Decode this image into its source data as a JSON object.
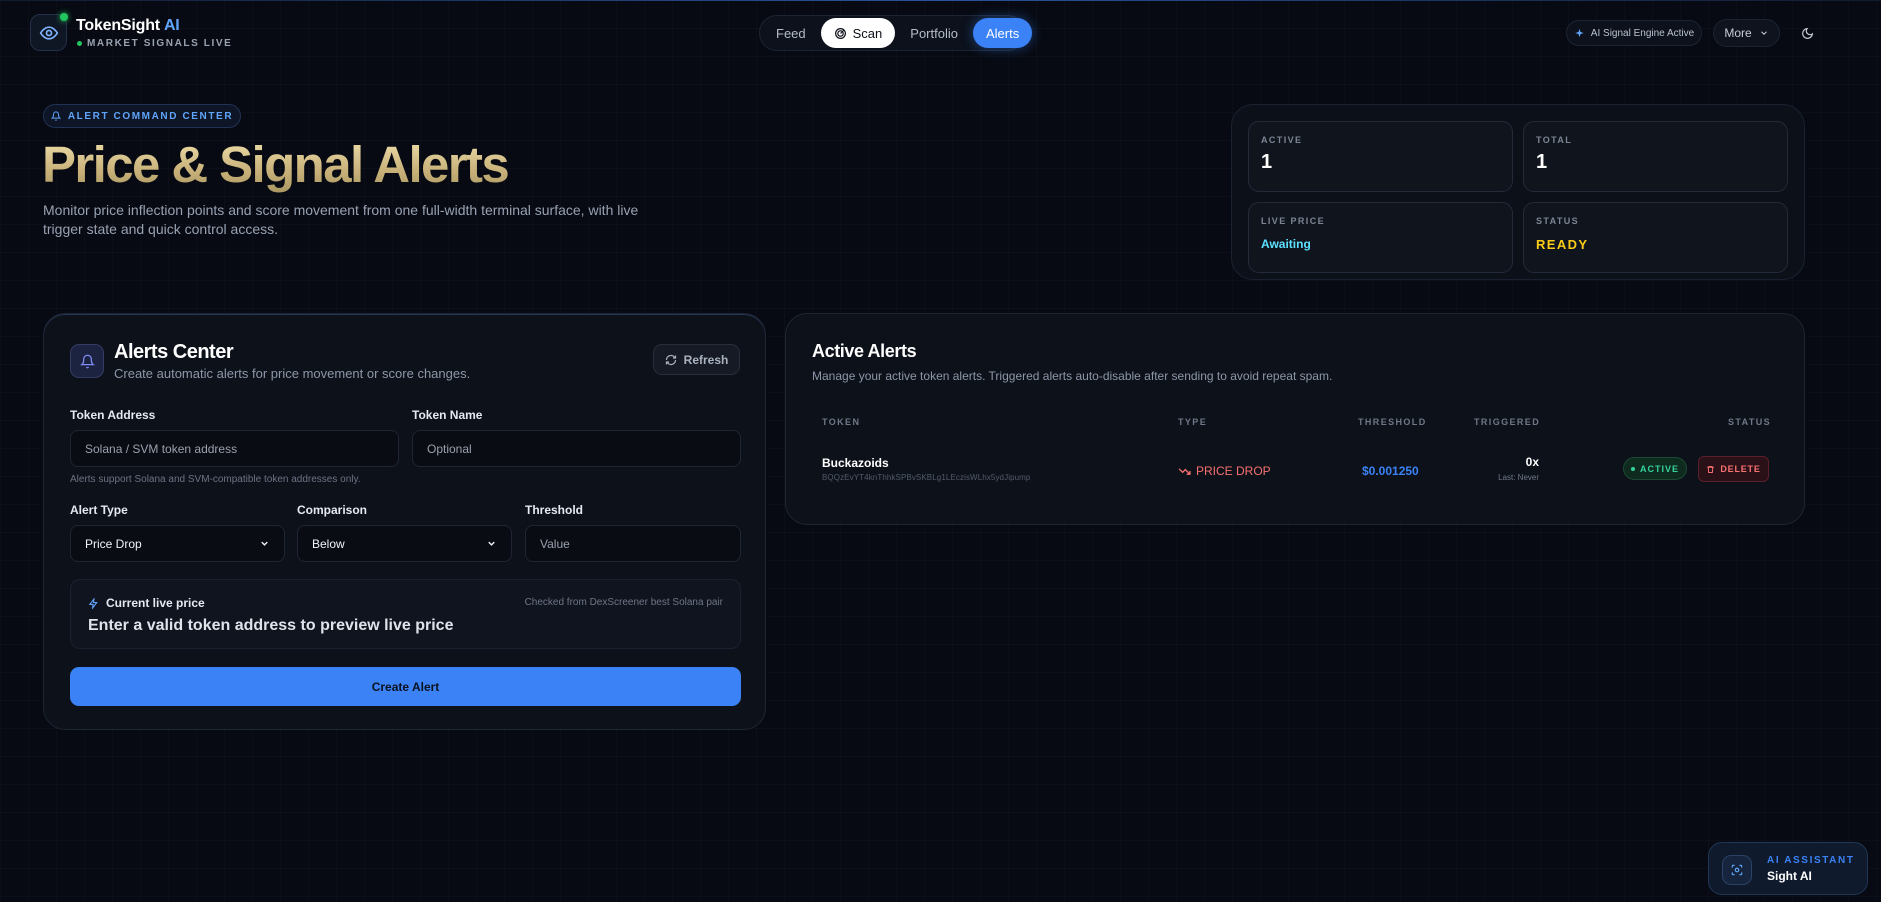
{
  "brand": {
    "name": "TokenSight",
    "name_ai": "AI",
    "subtitle": "MARKET SIGNALS LIVE"
  },
  "nav": {
    "items": [
      {
        "label": "Feed"
      },
      {
        "label": "Scan"
      },
      {
        "label": "Portfolio"
      },
      {
        "label": "Alerts"
      }
    ],
    "active": "Alerts"
  },
  "header": {
    "engine_status": "AI Signal Engine Active",
    "more_label": "More"
  },
  "hero": {
    "badge": "ALERT COMMAND CENTER",
    "title": "Price & Signal Alerts",
    "description": "Monitor price inflection points and score movement from one full-width terminal surface, with live trigger state and quick control access."
  },
  "stats": {
    "active": {
      "label": "ACTIVE",
      "value": "1"
    },
    "total": {
      "label": "TOTAL",
      "value": "1"
    },
    "live_price": {
      "label": "LIVE PRICE",
      "value": "Awaiting"
    },
    "status": {
      "label": "STATUS",
      "value": "READY"
    }
  },
  "alerts_center": {
    "title": "Alerts Center",
    "subtitle": "Create automatic alerts for price movement or score changes.",
    "refresh_label": "Refresh",
    "token_address": {
      "label": "Token Address",
      "placeholder": "Solana / SVM token address"
    },
    "token_name": {
      "label": "Token Name",
      "placeholder": "Optional"
    },
    "hint": "Alerts support Solana and SVM-compatible token addresses only.",
    "alert_type": {
      "label": "Alert Type",
      "value": "Price Drop"
    },
    "comparison": {
      "label": "Comparison",
      "value": "Below"
    },
    "threshold": {
      "label": "Threshold",
      "placeholder": "Value"
    },
    "live_price": {
      "title": "Current live price",
      "source": "Checked from DexScreener best Solana pair",
      "message": "Enter a valid token address to preview live price"
    },
    "create_label": "Create Alert"
  },
  "active_alerts": {
    "title": "Active Alerts",
    "subtitle": "Manage your active token alerts. Triggered alerts auto-disable after sending to avoid repeat spam.",
    "columns": [
      "TOKEN",
      "TYPE",
      "THRESHOLD",
      "TRIGGERED",
      "STATUS"
    ],
    "rows": [
      {
        "token": "Buckazoids",
        "address": "BQQzEvYT4knThhkSPBvSKBLg1LEczisWLhx5ydJipump",
        "type": "PRICE DROP",
        "threshold": "$0.001250",
        "triggered": "0x",
        "last": "Last: Never",
        "status": "ACTIVE",
        "delete_label": "DELETE"
      }
    ]
  },
  "assistant": {
    "label": "AI ASSISTANT",
    "name": "Sight AI"
  },
  "colors": {
    "accent": "#3b82f6",
    "success": "#34d399",
    "danger": "#f87171",
    "warning": "#facc15",
    "info": "#5ee0ff",
    "title_gold": "#d9c798"
  }
}
